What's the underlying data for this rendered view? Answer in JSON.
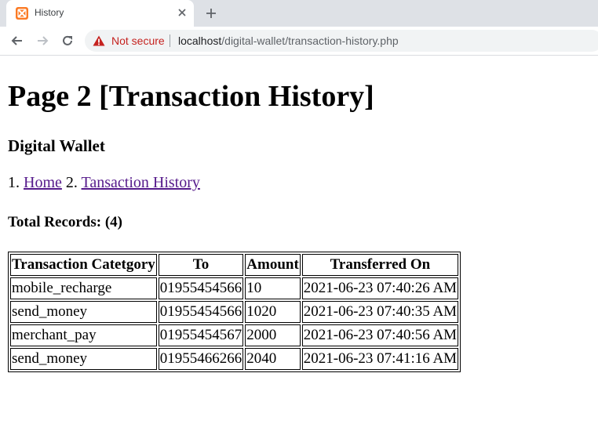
{
  "browser": {
    "tab_title": "History",
    "security_label": "Not secure",
    "url_host": "localhost",
    "url_path": "/digital-wallet/transaction-history.php",
    "icons": {
      "favicon": "xampp-icon",
      "tab_close": "close-icon",
      "new_tab": "plus-icon",
      "back": "arrow-left-icon",
      "forward": "arrow-right-icon",
      "reload": "reload-icon",
      "security": "warning-triangle-icon"
    },
    "colors": {
      "favicon": "#fb7a24",
      "not_secure": "#c5221f"
    }
  },
  "page": {
    "title": "Page 2 [Transaction History]",
    "site_name": "Digital Wallet",
    "breadcrumb": {
      "item1_prefix": "1.",
      "item1_label": "Home",
      "item2_prefix": "2.",
      "item2_label": "Tansaction History",
      "link_color": "#551a8b"
    },
    "total_records_label": "Total Records: (4)"
  },
  "table": {
    "headers": [
      "Transaction Catetgory",
      "To",
      "Amount",
      "Transferred On"
    ],
    "rows": [
      [
        "mobile_recharge",
        "01955454566",
        "10",
        "2021-06-23 07:40:26 AM"
      ],
      [
        "send_money",
        "01955454566",
        "1020",
        "2021-06-23 07:40:35 AM"
      ],
      [
        "merchant_pay",
        "01955454567",
        "2000",
        "2021-06-23 07:40:56 AM"
      ],
      [
        "send_money",
        "01955466266",
        "2040",
        "2021-06-23 07:41:16 AM"
      ]
    ]
  }
}
